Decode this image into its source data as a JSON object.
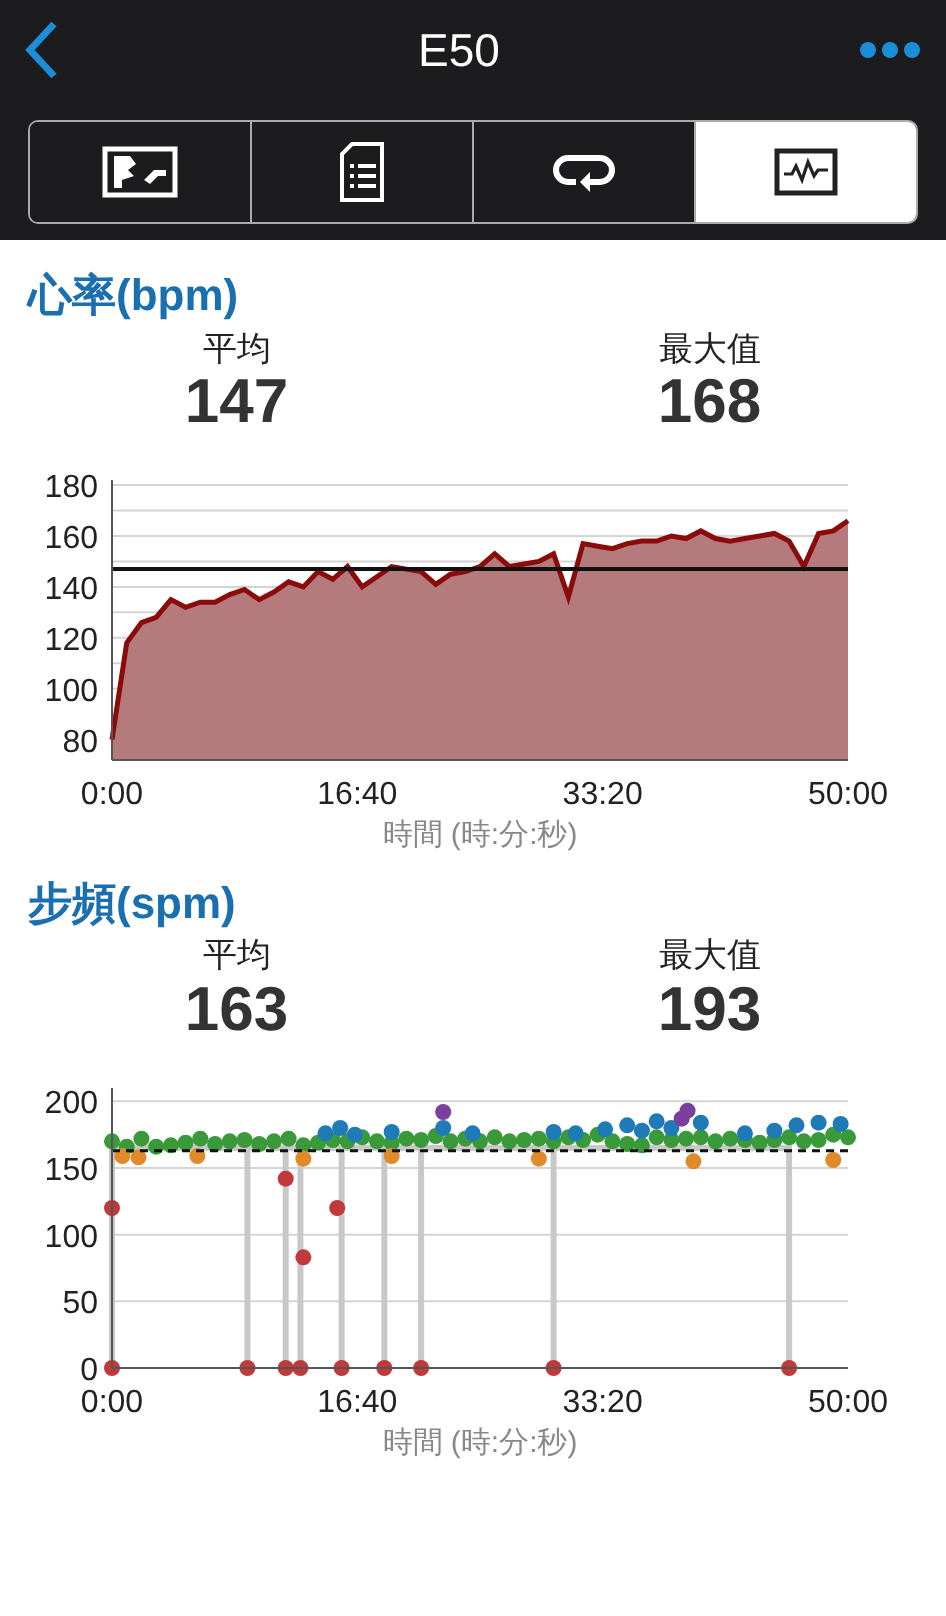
{
  "header": {
    "title": "E50"
  },
  "tabs": [
    {
      "selected": false
    },
    {
      "selected": false
    },
    {
      "selected": false
    },
    {
      "selected": true
    }
  ],
  "sections": [
    {
      "title": "心率(bpm)",
      "stats": [
        {
          "label": "平均",
          "value": "147"
        },
        {
          "label": "最大值",
          "value": "168"
        }
      ],
      "chart_data": {
        "type": "area",
        "xlabel": "時間 (時:分:秒)",
        "x": [
          0,
          1,
          2,
          3,
          4,
          5,
          6,
          7,
          8,
          9,
          10,
          11,
          12,
          13,
          14,
          15,
          16,
          17,
          18,
          19,
          20,
          21,
          22,
          23,
          24,
          25,
          26,
          27,
          28,
          29,
          30,
          31,
          32,
          33,
          34,
          35,
          36,
          37,
          38,
          39,
          40,
          41,
          42,
          43,
          44,
          45,
          46,
          47,
          48,
          49,
          50
        ],
        "grid": true,
        "series": [
          {
            "color": "#8b0a0a",
            "values": [
              80,
              118,
              126,
              128,
              135,
              132,
              134,
              134,
              137,
              139,
              135,
              138,
              142,
              140,
              146,
              143,
              148,
              140,
              144,
              148,
              147,
              146,
              141,
              145,
              146,
              148,
              153,
              148,
              149,
              150,
              153,
              136,
              157,
              156,
              155,
              157,
              158,
              158,
              160,
              159,
              162,
              159,
              158,
              159,
              160,
              161,
              158,
              148,
              161,
              162,
              166
            ]
          }
        ],
        "xlim": [
          0,
          50
        ],
        "ylim": [
          72,
          182
        ],
        "xticks": [
          {
            "value": 0,
            "label": "0:00"
          },
          {
            "value": 16.667,
            "label": "16:40"
          },
          {
            "value": 33.333,
            "label": "33:20"
          },
          {
            "value": 50,
            "label": "50:00"
          }
        ],
        "yticks": [
          80,
          100,
          120,
          140,
          160,
          180
        ],
        "ref_lines": [
          {
            "axis": "y",
            "value": 147
          }
        ]
      }
    },
    {
      "title": "步頻(spm)",
      "stats": [
        {
          "label": "平均",
          "value": "163"
        },
        {
          "label": "最大值",
          "value": "193"
        }
      ],
      "chart_data": {
        "type": "scatter",
        "xlabel": "時間 (時:分:秒)",
        "grid": true,
        "series": [
          {
            "type": "line",
            "color": "#c8c8c8",
            "x": [
              0,
              0,
              0,
              9.2,
              9.2,
              9.2,
              11.8,
              11.8,
              11.8,
              12.8,
              12.8,
              12.8,
              15.6,
              15.6,
              15.6,
              18.5,
              18.5,
              18.5,
              21,
              21,
              21,
              30,
              30,
              30,
              46,
              46,
              46
            ],
            "values": [
              165,
              0,
              165,
              165,
              0,
              165,
              165,
              0,
              165,
              165,
              0,
              165,
              165,
              0,
              165,
              165,
              0,
              165,
              165,
              0,
              165,
              165,
              0,
              165,
              165,
              0,
              165
            ]
          },
          {
            "color": "#3a9a3a",
            "x": [
              0,
              1,
              2,
              3,
              4,
              5,
              6,
              7,
              8,
              9,
              10,
              11,
              12,
              13,
              14,
              15,
              16,
              17,
              18,
              19,
              20,
              21,
              22,
              23,
              24,
              25,
              26,
              27,
              28,
              29,
              30,
              31,
              32,
              33,
              34,
              35,
              36,
              37,
              38,
              39,
              40,
              41,
              42,
              43,
              44,
              45,
              46,
              47,
              48,
              49,
              50
            ],
            "values": [
              170,
              166,
              172,
              166,
              167,
              169,
              172,
              168,
              170,
              171,
              168,
              170,
              172,
              167,
              169,
              171,
              170,
              173,
              170,
              169,
              172,
              171,
              174,
              170,
              172,
              170,
              173,
              170,
              171,
              172,
              170,
              173,
              171,
              175,
              170,
              168,
              167,
              173,
              171,
              172,
              173,
              170,
              172,
              171,
              169,
              171,
              173,
              170,
              171,
              175,
              173
            ]
          },
          {
            "color": "#1f7ab8",
            "x": [
              14.5,
              15.5,
              16.5,
              19,
              22.5,
              24.5,
              30,
              31.5,
              33.5,
              35,
              36,
              37,
              38,
              38.5,
              40,
              43,
              45,
              46.5,
              48,
              49.5
            ],
            "values": [
              176,
              180,
              175,
              177,
              180,
              176,
              177,
              176,
              179,
              182,
              178,
              185,
              180,
              null,
              184,
              176,
              178,
              182,
              184,
              183
            ]
          },
          {
            "color": "#e08a2a",
            "x": [
              0.7,
              1.8,
              5.8,
              13,
              19,
              29,
              39.5,
              49
            ],
            "values": [
              159,
              158,
              159,
              157,
              159,
              157,
              155,
              156
            ]
          },
          {
            "color": "#c0393b",
            "x": [
              0,
              0,
              9.2,
              11.8,
              11.8,
              13,
              12.8,
              15.3,
              15.6,
              18.5,
              21,
              30,
              46
            ],
            "values": [
              120,
              0,
              0,
              142,
              0,
              83,
              0,
              120,
              0,
              0,
              0,
              0,
              0
            ]
          },
          {
            "color": "#7b3fa0",
            "x": [
              22.5,
              38.7,
              39.1
            ],
            "values": [
              192,
              187,
              193
            ]
          }
        ],
        "xlim": [
          0,
          50
        ],
        "ylim": [
          0,
          210
        ],
        "xticks": [
          {
            "value": 0,
            "label": "0:00"
          },
          {
            "value": 16.667,
            "label": "16:40"
          },
          {
            "value": 33.333,
            "label": "33:20"
          },
          {
            "value": 50,
            "label": "50:00"
          }
        ],
        "yticks": [
          0,
          50,
          100,
          150,
          200
        ],
        "ref_lines": [
          {
            "axis": "y",
            "value": 163
          }
        ]
      }
    }
  ]
}
